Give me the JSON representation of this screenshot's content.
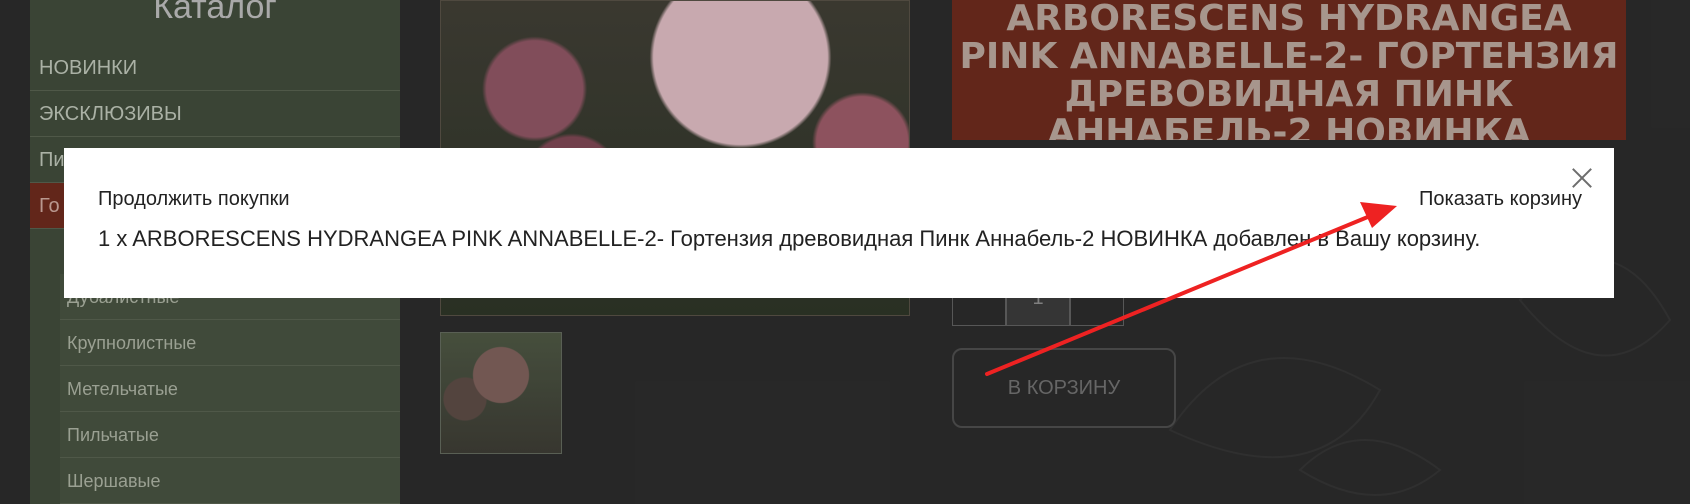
{
  "sidebar": {
    "title": "Каталог",
    "items": [
      {
        "label": "НОВИНКИ"
      },
      {
        "label": "ЭКСКЛЮЗИВЫ"
      },
      {
        "label": "Пи"
      },
      {
        "label": "Го"
      }
    ],
    "subitems": [
      {
        "label": "Дубалистные"
      },
      {
        "label": "Крупнолистные"
      },
      {
        "label": "Метельчатые"
      },
      {
        "label": "Пильчатые"
      },
      {
        "label": "Шершавые"
      }
    ]
  },
  "product": {
    "title": "ARBORESCENS HYDRANGEA PINK ANNABELLE-2- ГОРТЕНЗИЯ ДРЕВОВИДНАЯ ПИНК АННАБЕЛЬ-2 НОВИНКА",
    "quantity": "1",
    "cart_button": "В КОРЗИНУ"
  },
  "modal": {
    "continue_label": "Продолжить покупки",
    "show_cart_label": "Показать корзину",
    "message": "1 x ARBORESCENS HYDRANGEA PINK ANNABELLE-2- Гортензия древовидная Пинк Аннабель-2 НОВИНКА добавлен в Вашу корзину."
  },
  "colors": {
    "annotation_arrow": "#ee2222",
    "accent": "#6b2a1d"
  }
}
